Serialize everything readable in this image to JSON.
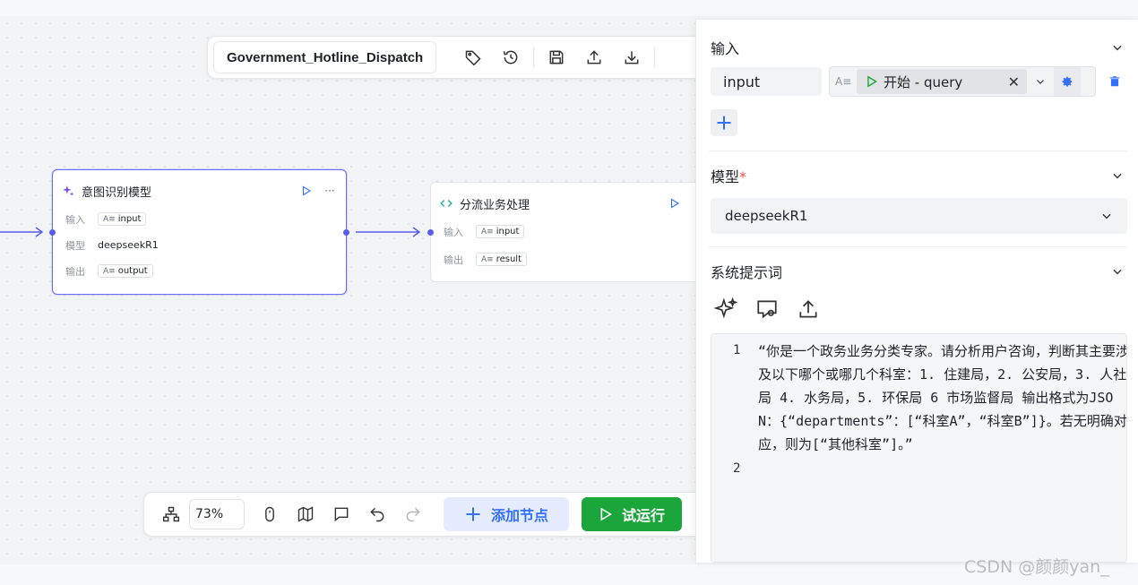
{
  "workflow": {
    "name": "Government_Hotline_Dispatch"
  },
  "nodes": {
    "intent": {
      "title": "意图识别模型",
      "input_label": "输入",
      "input_value": "input",
      "model_label": "模型",
      "model_value": "deepseekR1",
      "output_label": "输出",
      "output_value": "output"
    },
    "dispatch": {
      "title": "分流业务处理",
      "input_label": "输入",
      "input_value": "input",
      "output_label": "输出",
      "output_value": "result"
    }
  },
  "bottom_toolbar": {
    "zoom": "73%",
    "add_node_label": "添加节点",
    "run_label": "试运行"
  },
  "panel": {
    "input_section": {
      "title": "输入",
      "param_name": "input",
      "ref_label": "开始 - query"
    },
    "model_section": {
      "title": "模型",
      "required_mark": "*",
      "selected_model": "deepseekR1"
    },
    "prompt_section": {
      "title": "系统提示词",
      "line1_no": "1",
      "line2_no": "2",
      "line1_text": "“你是一个政务业务分类专家。请分析用户咨询，判断其主要涉及以下哪个或哪几个科室：1. 住建局，2. 公安局，3. 人社局 4. 水务局，5. 环保局 6 市场监督局 输出格式为JSON：{“departments”：[“科室A”，“科室B”]}。若无明确对应，则为[“其他科室”]。”"
    }
  },
  "watermark": "CSDN @颜颜yan_",
  "colors": {
    "accent": "#3370ff",
    "selected_border": "#6e6cf0",
    "run_green": "#1ba63c",
    "danger": "#f54a45"
  }
}
